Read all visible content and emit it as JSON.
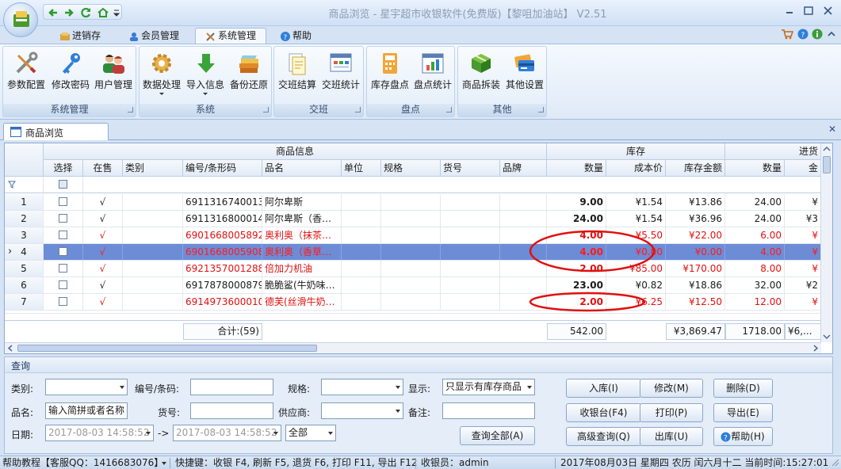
{
  "window": {
    "title": "商品浏览 - 星宇超市收银软件(免费版)【黎咀加油站】 V2.51"
  },
  "ribbon": {
    "tabs": [
      {
        "label": "进销存",
        "icon": "boxes-icon"
      },
      {
        "label": "会员管理",
        "icon": "members-icon"
      },
      {
        "label": "系统管理",
        "icon": "tools-icon",
        "active": true
      },
      {
        "label": "帮助",
        "icon": "help-icon"
      }
    ],
    "groups": [
      {
        "label": "系统管理",
        "buttons": [
          "参数配置",
          "修改密码",
          "用户管理"
        ]
      },
      {
        "label": "系统",
        "buttons": [
          "数据处理",
          "导入信息",
          "备份还原"
        ]
      },
      {
        "label": "交班",
        "buttons": [
          "交班结算",
          "交班统计"
        ]
      },
      {
        "label": "盘点",
        "buttons": [
          "库存盘点",
          "盘点统计"
        ]
      },
      {
        "label": "其他",
        "buttons": [
          "商品拆装",
          "其他设置"
        ]
      }
    ]
  },
  "doc_tab": {
    "label": "商品浏览"
  },
  "grid": {
    "band_headers": [
      "商品信息",
      "库存",
      "进货"
    ],
    "columns": [
      "选择",
      "在售",
      "类别",
      "编号/条形码",
      "品名",
      "单位",
      "规格",
      "货号",
      "品牌",
      "数量",
      "成本价",
      "库存金额",
      "数量",
      "金"
    ],
    "rows": [
      {
        "n": "1",
        "on_sale": "√",
        "code": "6911316740013",
        "name": "阿尔卑斯",
        "qty": "9.00",
        "cost": "¥1.54",
        "amount": "¥13.86",
        "in_qty": "24.00",
        "in_amt": "¥",
        "red": false,
        "selected": false
      },
      {
        "n": "2",
        "on_sale": "√",
        "code": "6911316800014",
        "name": "阿尔卑斯（香…",
        "qty": "24.00",
        "cost": "¥1.54",
        "amount": "¥36.96",
        "in_qty": "24.00",
        "in_amt": "¥3",
        "red": false,
        "selected": false
      },
      {
        "n": "3",
        "on_sale": "√",
        "code": "6901668005892",
        "name": "奥利奥（抹茶…",
        "qty": "4.00",
        "cost": "¥5.50",
        "amount": "¥22.00",
        "in_qty": "6.00",
        "in_amt": "¥",
        "red": true,
        "selected": false
      },
      {
        "n": "4",
        "on_sale": "√",
        "code": "6901668005908",
        "name": "奥利奥（香草…",
        "qty": "4.00",
        "cost": "¥0.00",
        "amount": "¥0.00",
        "in_qty": "4.00",
        "in_amt": "¥",
        "red": true,
        "selected": true
      },
      {
        "n": "5",
        "on_sale": "√",
        "code": "6921357001288",
        "name": "倍加力机油",
        "qty": "2.00",
        "cost": "¥85.00",
        "amount": "¥170.00",
        "in_qty": "8.00",
        "in_amt": "¥",
        "red": true,
        "selected": false
      },
      {
        "n": "6",
        "on_sale": "√",
        "code": "6917878000879",
        "name": "脆脆鲨(牛奶味…",
        "qty": "23.00",
        "cost": "¥0.82",
        "amount": "¥18.86",
        "in_qty": "32.00",
        "in_amt": "¥2",
        "red": false,
        "selected": false
      },
      {
        "n": "7",
        "on_sale": "√",
        "code": "6914973600010",
        "name": "德芙(丝滑牛奶…",
        "qty": "2.00",
        "cost": "¥6.25",
        "amount": "¥12.50",
        "in_qty": "12.00",
        "in_amt": "¥",
        "red": true,
        "selected": false
      }
    ],
    "summary": {
      "count": "合计:(59)",
      "qty": "542.00",
      "amount": "¥3,869.47",
      "in_qty": "1718.00",
      "in_amt": "¥6,..."
    }
  },
  "query": {
    "title": "查询",
    "labels": {
      "category": "类别:",
      "code": "编号/条码:",
      "spec": "规格:",
      "display": "显示:",
      "name": "品名:",
      "item_no": "货号:",
      "supplier": "供应商:",
      "remark": "备注:",
      "date": "日期:",
      "arrow": "->"
    },
    "name_placeholder": "输入简拼或者名称",
    "display_value": "只显示有库存商品",
    "date_from": "2017-08-03 14:58:52",
    "date_to": "2017-08-03 14:58:52",
    "range_value": "全部",
    "show_all_button": "查询全部(A)",
    "buttons": [
      "入库(I)",
      "修改(M)",
      "删除(D)",
      "收银台(F4)",
      "打印(P)",
      "导出(E)",
      "高级查询(Q)",
      "出库(U)",
      "帮助(H)"
    ]
  },
  "statusbar": {
    "help": "帮助教程【客服QQ：1416683076】",
    "shortcuts": "快捷键：收银 F4, 刷新 F5, 退货 F6, 打印 F11, 导出 F12",
    "cashier": "收银员：admin",
    "datetime": "2017年08月03日 星期四 农历 闰六月十二 当前时间:15:27:01"
  },
  "colors": {
    "accent": "#6d8cd6",
    "warning_text": "#e01010",
    "annotation": "#e01010"
  }
}
